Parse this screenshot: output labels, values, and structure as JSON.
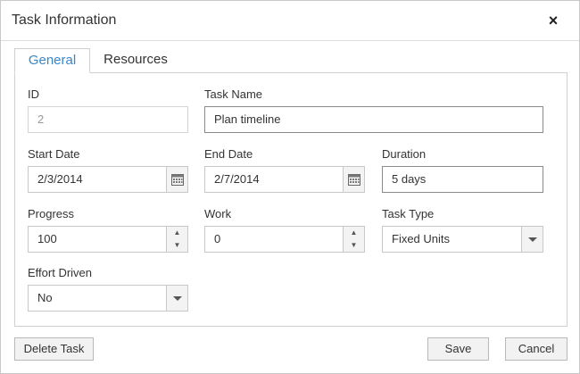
{
  "dialog": {
    "title": "Task Information",
    "close_symbol": "×"
  },
  "tabs": [
    {
      "label": "General",
      "active": true
    },
    {
      "label": "Resources",
      "active": false
    }
  ],
  "form": {
    "id": {
      "label": "ID",
      "value": "2"
    },
    "task_name": {
      "label": "Task Name",
      "value": "Plan timeline"
    },
    "start_date": {
      "label": "Start Date",
      "value": "2/3/2014"
    },
    "end_date": {
      "label": "End Date",
      "value": "2/7/2014"
    },
    "duration": {
      "label": "Duration",
      "value": "5 days"
    },
    "progress": {
      "label": "Progress",
      "value": "100"
    },
    "work": {
      "label": "Work",
      "value": "0"
    },
    "task_type": {
      "label": "Task Type",
      "value": "Fixed Units"
    },
    "effort_driven": {
      "label": "Effort Driven",
      "value": "No"
    }
  },
  "footer": {
    "delete_label": "Delete Task",
    "save_label": "Save",
    "cancel_label": "Cancel"
  },
  "colors": {
    "active_tab": "#3a87c8",
    "border": "#c8c8c8"
  },
  "icons": {
    "close": "close-icon",
    "calendar": "calendar-icon",
    "dropdown": "chevron-down-icon",
    "spin_up": "spin-up-icon",
    "spin_down": "spin-down-icon"
  }
}
